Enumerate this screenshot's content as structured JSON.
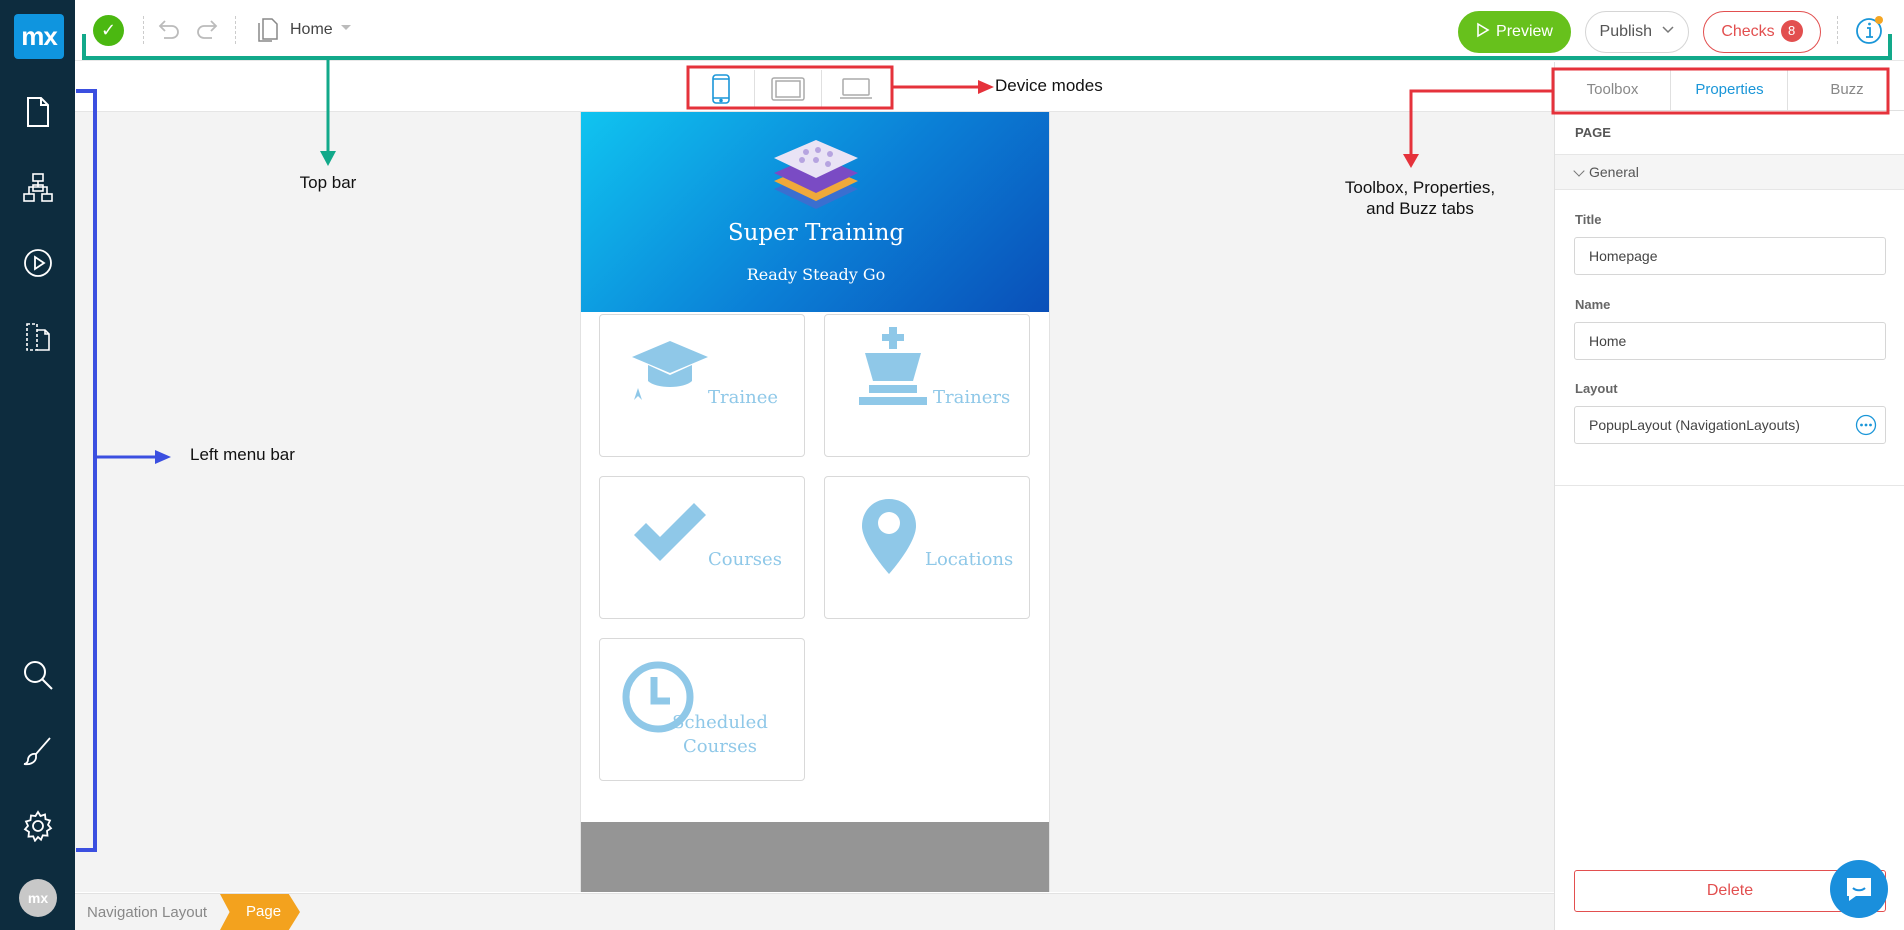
{
  "app": {
    "logo": "mx"
  },
  "leftbar": {
    "icons": [
      "pages-icon",
      "domain-model-icon",
      "microflow-icon",
      "app-explorer-icon",
      "search-icon",
      "theme-brush-icon",
      "settings-gear-icon"
    ],
    "avatar": "mx"
  },
  "topbar": {
    "page_selector": "Home",
    "preview_label": "Preview",
    "publish_label": "Publish",
    "checks_label": "Checks",
    "checks_count": "8"
  },
  "device_modes": [
    "phone-mode-icon",
    "tablet-mode-icon",
    "desktop-mode-icon"
  ],
  "canvas": {
    "hero_title": "Super Training",
    "hero_subtitle": "Ready Steady Go",
    "tiles": [
      "Trainee",
      "Trainers",
      "Courses",
      "Locations",
      "Scheduled Courses"
    ]
  },
  "rpanel": {
    "tabs": [
      "Toolbox",
      "Properties",
      "Buzz"
    ],
    "active_tab": "Properties",
    "section": "PAGE",
    "group": "General",
    "fields": [
      {
        "label": "Title",
        "value": "Homepage"
      },
      {
        "label": "Name",
        "value": "Home"
      },
      {
        "label": "Layout",
        "value": "PopupLayout (NavigationLayouts)"
      }
    ],
    "delete_label": "Delete"
  },
  "breadcrumb": [
    "Navigation Layout",
    "Page"
  ],
  "annotations": {
    "top_bar": "Top bar",
    "device_modes": "Device modes",
    "tabs_line1": "Toolbox, Properties,",
    "tabs_line2": "and Buzz tabs",
    "left_menu": "Left menu bar"
  },
  "colors": {
    "sidebar": "#0d2c3e",
    "accent_blue": "#1a96d8",
    "preview_green": "#67c11c",
    "checks_red": "#e24f4f",
    "breadcrumb_orange": "#f3a21e",
    "annotation_teal": "#12a98a",
    "annotation_red": "#e5323b",
    "annotation_blue": "#3b4fe0"
  }
}
